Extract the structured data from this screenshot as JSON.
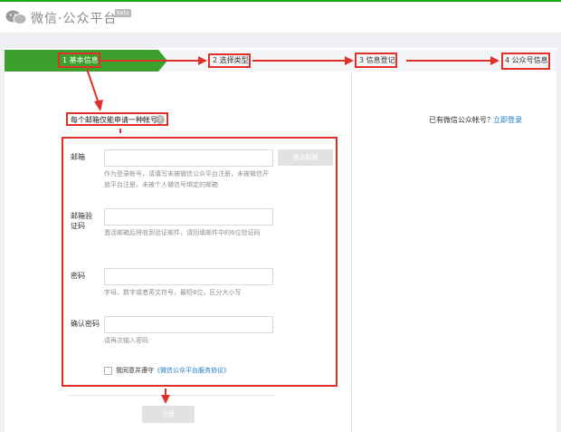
{
  "header": {
    "logo_text": "微信·公众平台",
    "beta_badge": "beta",
    "logo_icon": "wechat-icon"
  },
  "steps": [
    {
      "label": "1 基本信息",
      "active": true
    },
    {
      "label": "2 选择类型",
      "active": false
    },
    {
      "label": "3 信息登记",
      "active": false
    },
    {
      "label": "4 公众号信息",
      "active": false
    }
  ],
  "form": {
    "notice": "每个邮箱仅能申请一种帐号",
    "help_icon_glyph": "?",
    "email": {
      "label": "邮箱",
      "value": "",
      "placeholder": "",
      "activate_button": "激活邮箱",
      "hint": "作为登录帐号，请填写未被微信公众平台注册，未被微信开放平台注册，未被个人微信号绑定的邮箱"
    },
    "code": {
      "label": "邮箱验证码",
      "value": "",
      "hint": "激活邮箱后将收到验证邮件，请回填邮件中的6位验证码"
    },
    "password": {
      "label": "密码",
      "value": "",
      "hint": "字母、数字或者英文符号，最短8位，区分大小写"
    },
    "confirm": {
      "label": "确认密码",
      "value": "",
      "hint": "请再次输入密码"
    },
    "agreement": {
      "prefix": "我同意并遵守",
      "link": "《微信公众平台服务协议》"
    },
    "register_button": "注册"
  },
  "sidebar": {
    "existing_account_text": "已有微信公众帐号？",
    "login_link": "立即登录"
  },
  "colors": {
    "brand_green": "#3ca02d",
    "annotation_red": "#e0302a",
    "link_blue": "#1a7bc9"
  }
}
